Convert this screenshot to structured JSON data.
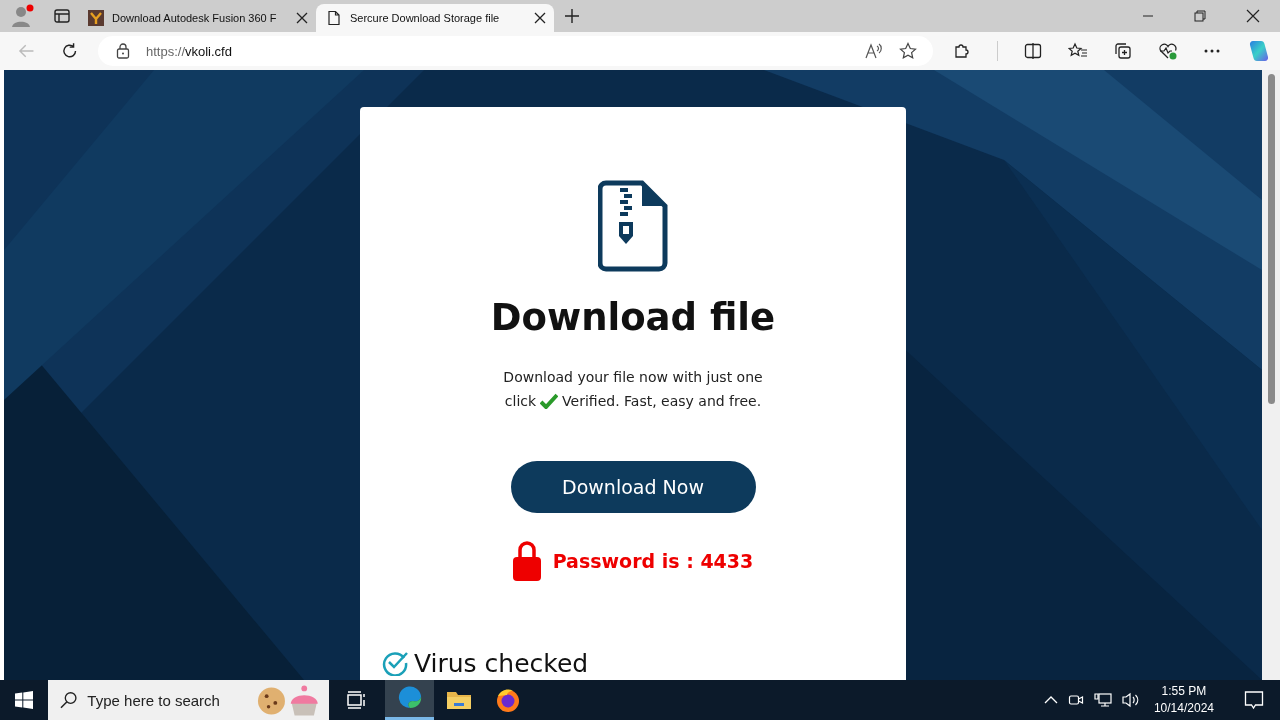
{
  "browser": {
    "tabs": [
      {
        "title": "Download Autodesk Fusion 360 F",
        "selected": false
      },
      {
        "title": "Sercure Download Storage file",
        "selected": true
      }
    ],
    "url_scheme": "https://",
    "url_host": "vkoli.cfd"
  },
  "page": {
    "heading": "Download file",
    "description": "Download your file now with just one",
    "description_end": "click",
    "verified_text": "Verified. Fast, easy and free.",
    "button": "Download Now",
    "password": "Password is : 4433",
    "section": "Virus checked"
  },
  "taskbar": {
    "search_placeholder": "Type here to search",
    "time": "1:55 PM",
    "date": "10/14/2024",
    "apps": [
      {
        "kind": "edge",
        "selected": true
      },
      {
        "kind": "folder",
        "selected": false
      },
      {
        "kind": "firefox",
        "selected": false
      }
    ]
  }
}
